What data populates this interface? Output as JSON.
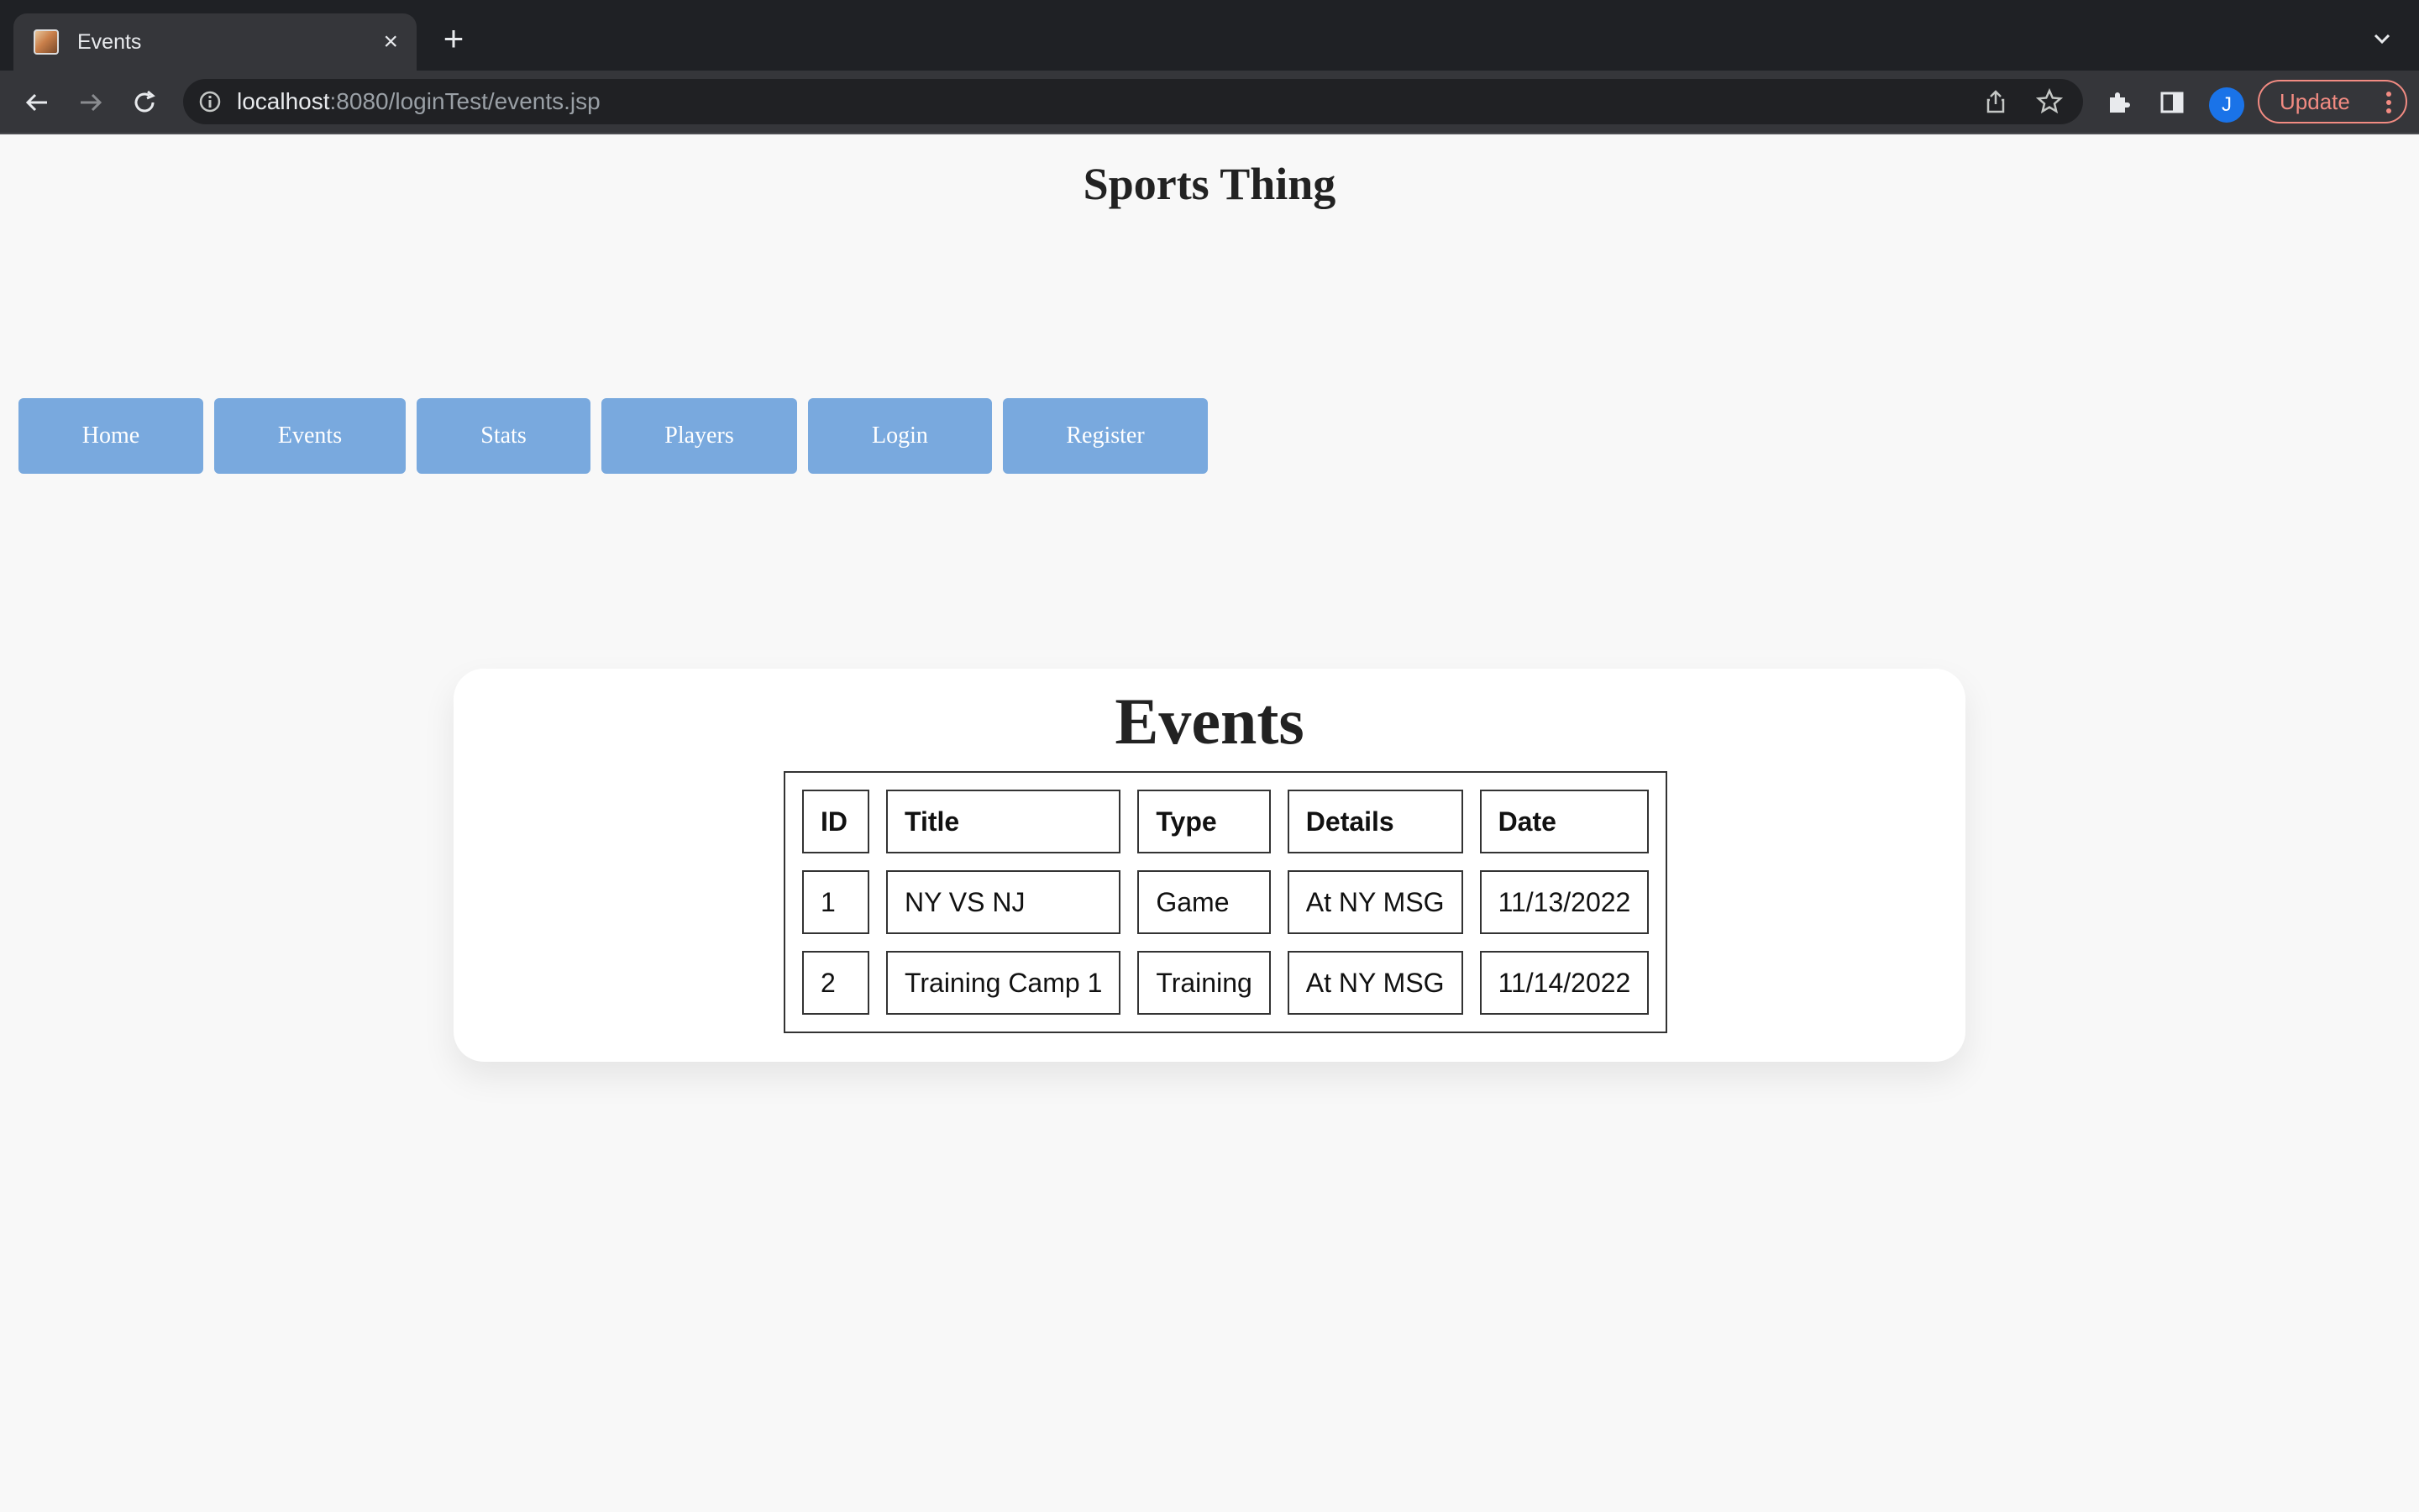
{
  "browser": {
    "tab_title": "Events",
    "url_host": "localhost",
    "url_rest": ":8080/loginTest/events.jsp",
    "avatar_initial": "J",
    "update_label": "Update"
  },
  "site": {
    "title": "Sports Thing"
  },
  "nav": {
    "items": [
      {
        "label": "Home"
      },
      {
        "label": "Events"
      },
      {
        "label": "Stats"
      },
      {
        "label": "Players"
      },
      {
        "label": "Login"
      },
      {
        "label": "Register"
      }
    ]
  },
  "events": {
    "heading": "Events",
    "columns": [
      "ID",
      "Title",
      "Type",
      "Details",
      "Date"
    ],
    "rows": [
      [
        "1",
        "NY VS NJ",
        "Game",
        "At NY MSG",
        "11/13/2022"
      ],
      [
        "2",
        "Training Camp 1",
        "Training",
        "At NY MSG",
        "11/14/2022"
      ]
    ]
  },
  "colors": {
    "nav_button": "#79a9de",
    "page_bg": "#f8f8f8",
    "chrome_bg": "#35363a"
  }
}
